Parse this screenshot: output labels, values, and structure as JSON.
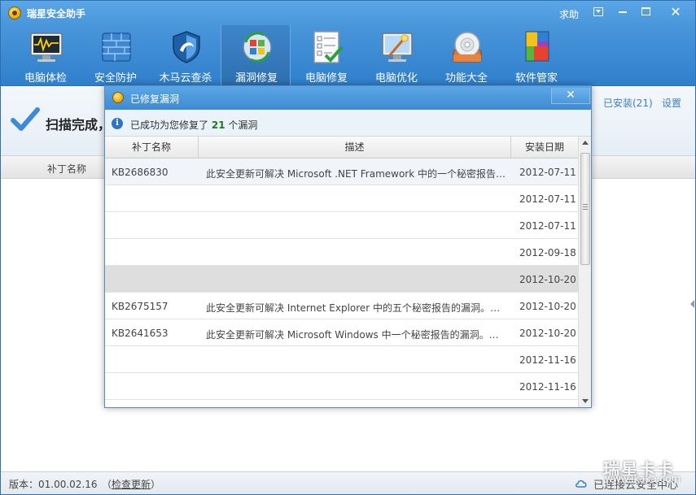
{
  "app": {
    "title": "瑞星安全助手",
    "help": "求助"
  },
  "toolbar": {
    "items": [
      {
        "label": "电脑体检"
      },
      {
        "label": "安全防护"
      },
      {
        "label": "木马云查杀"
      },
      {
        "label": "漏洞修复"
      },
      {
        "label": "电脑修复"
      },
      {
        "label": "电脑优化"
      },
      {
        "label": "功能大全"
      },
      {
        "label": "软件管家"
      }
    ]
  },
  "main": {
    "scan_title": "扫描完成，",
    "installed_link": "已安装(21)",
    "settings_link": "设置",
    "column_patch": "补丁名称"
  },
  "dialog": {
    "title": "已修复漏洞",
    "info_prefix": "已成功为您修复了",
    "info_count": "21",
    "info_suffix": "个漏洞",
    "columns": {
      "patch": "补丁名称",
      "desc": "描述",
      "date": "安装日期"
    },
    "rows": [
      {
        "patch": "KB2686830",
        "desc": "此安全更新可解决 Microsoft .NET Framework 中的一个秘密报告的漏洞。",
        "date": "2012-07-11"
      },
      {
        "patch": "",
        "desc": "",
        "date": "2012-07-11"
      },
      {
        "patch": "",
        "desc": "",
        "date": "2012-07-11"
      },
      {
        "patch": "",
        "desc": "",
        "date": "2012-09-18"
      },
      {
        "patch": "",
        "desc": "",
        "date": "2012-10-20"
      },
      {
        "patch": "KB2675157",
        "desc": "此安全更新可解决 Internet Explorer 中的五个秘密报告的漏洞。最严重的漏洞",
        "date": "2012-10-20"
      },
      {
        "patch": "KB2641653",
        "desc": "此安全更新可解决 Microsoft Windows 中一个秘密报告的漏洞。此漏洞",
        "date": "2012-10-20"
      },
      {
        "patch": "",
        "desc": "",
        "date": "2012-11-16"
      },
      {
        "patch": "",
        "desc": "",
        "date": "2012-11-16"
      },
      {
        "patch": "",
        "desc": "",
        "date": ""
      }
    ]
  },
  "statusbar": {
    "version": "版本：01.00.02.16",
    "check_update": "检查更新",
    "connect": "已连接云安全中心"
  },
  "watermark": {
    "brand": "瑞星卡卡",
    "url": "www.ikaka.com"
  },
  "colors": {
    "titlebar": "#4a96db",
    "toolbar": "#2f7fcb",
    "info_count": "#1a7a1a",
    "link": "#3a7dc7"
  },
  "icons": [
    "monitor-checkup-icon",
    "firewall-shield-icon",
    "trojan-cloud-scan-icon",
    "vulnerability-repair-icon",
    "pc-repair-checklist-icon",
    "pc-optimize-icon",
    "toolbox-disc-icon",
    "software-manager-icon"
  ]
}
